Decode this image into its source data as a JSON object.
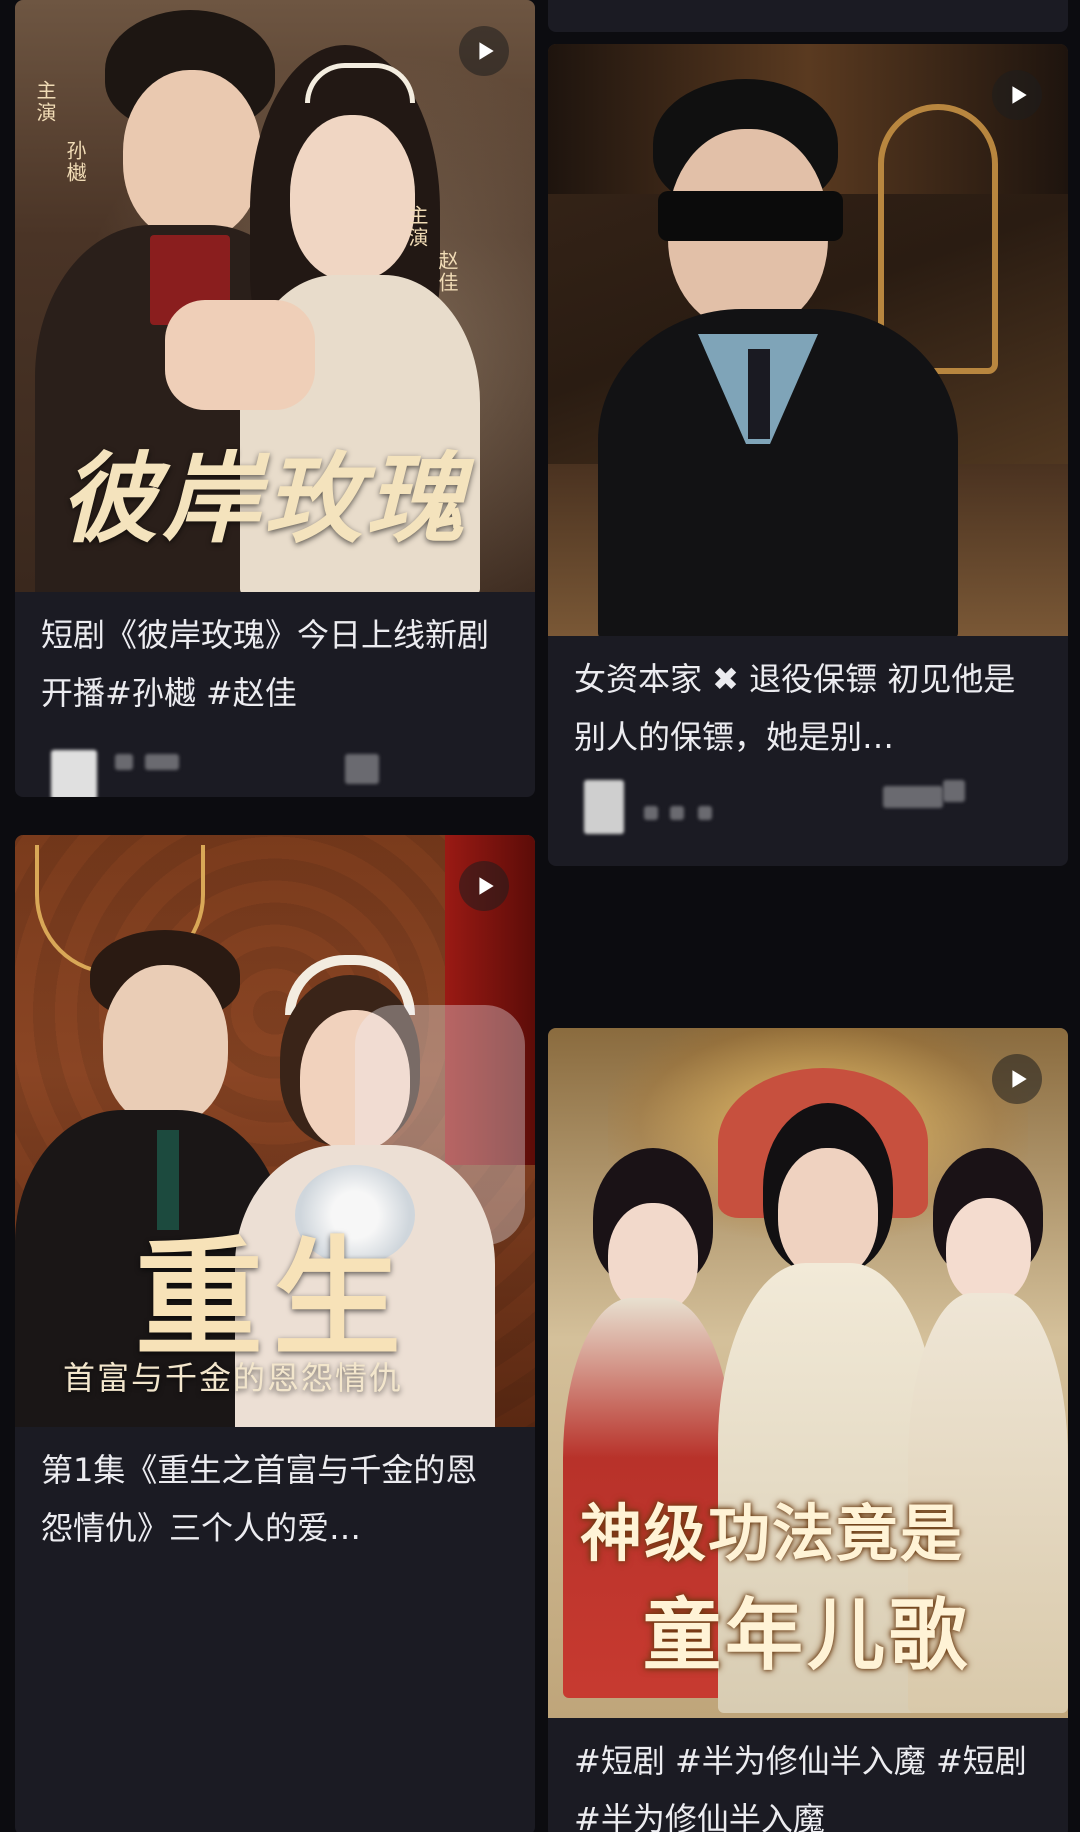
{
  "cards": [
    {
      "id": "rose",
      "caption": "短剧《彼岸玫瑰》今日上线新剧开播#孙樾  #赵佳",
      "poster_title": "彼岸玫瑰",
      "credits": [
        "主演",
        "孙樾",
        "主演",
        "赵佳"
      ],
      "colors": {
        "bg": "#5a3e2d",
        "accent": "#c9a474"
      }
    },
    {
      "id": "bodyguard",
      "caption": "女资本家 ✖ 退役保镖 初见他是别人的保镖，她是别…",
      "colors": {
        "bg": "#2a1c14",
        "accent": "#b8863f"
      }
    },
    {
      "id": "rebirth",
      "caption": "第1集《重生之首富与千金的恩怨情仇》三个人的爱…",
      "poster_title": "重生",
      "poster_subtitle": "首富与千金的恩怨情仇",
      "colors": {
        "bg": "#6b3419",
        "accent": "#f2d7a6"
      }
    },
    {
      "id": "xianxia",
      "caption": "#短剧 #半为修仙半入魔 #短剧 #半为修仙半入魔",
      "poster_title_line1": "神级功法竟是",
      "poster_title_line2": "童年儿歌",
      "colors": {
        "bg": "#c9b48c",
        "accent": "#e6c46a"
      }
    }
  ],
  "icons": {
    "play": "play-icon"
  }
}
